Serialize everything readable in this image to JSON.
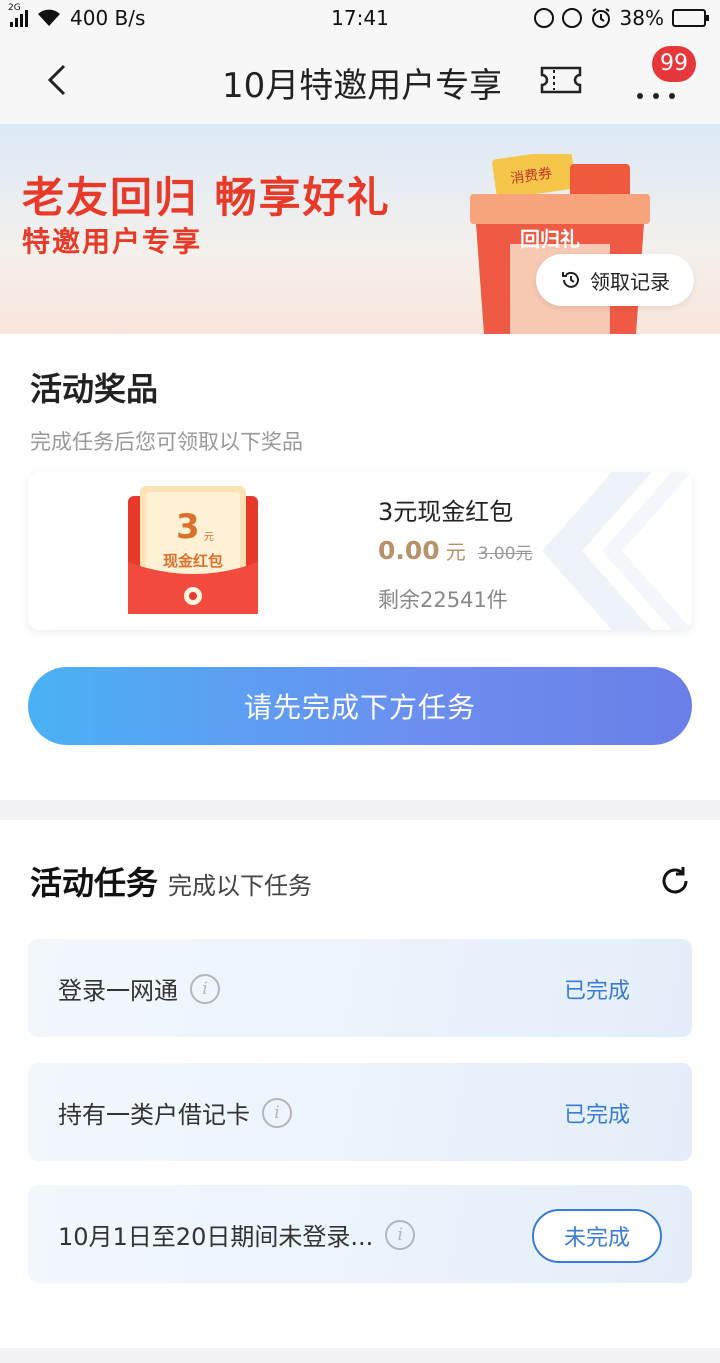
{
  "status_bar": {
    "network": "2G",
    "speed": "400 B/s",
    "time": "17:41",
    "battery": "38%",
    "battery_level": 0.38
  },
  "nav": {
    "title": "10月特邀用户专享",
    "badge": "99"
  },
  "banner": {
    "headline": "老友回归  畅享好礼",
    "subline": "特邀用户专享",
    "gift_tag": "回归礼",
    "coupon_tag": "消费券",
    "record_button": "领取记录"
  },
  "prize_section": {
    "title": "活动奖品",
    "subtitle": "完成任务后您可领取以下奖品",
    "prize": {
      "envelope_amount": "3",
      "envelope_unit": "元",
      "envelope_label": "现金红包",
      "name": "3元现金红包",
      "price": "0.00",
      "price_unit": "元",
      "original_price": "3.00元",
      "stock": "剩余22541件"
    },
    "cta": "请先完成下方任务"
  },
  "task_section": {
    "title": "活动任务",
    "subtitle": "完成以下任务",
    "tasks": [
      {
        "label": "登录一网通",
        "status": "已完成"
      },
      {
        "label": "持有一类户借记卡",
        "status": "已完成"
      },
      {
        "label": "10月1日至20日期间未登录...",
        "status": "未完成"
      }
    ]
  },
  "colors": {
    "accent_red": "#e83a28",
    "link_blue": "#3a7bd5",
    "gold": "#b8926a",
    "cta_start": "#4bb1f5",
    "cta_end": "#6a7fe8"
  }
}
